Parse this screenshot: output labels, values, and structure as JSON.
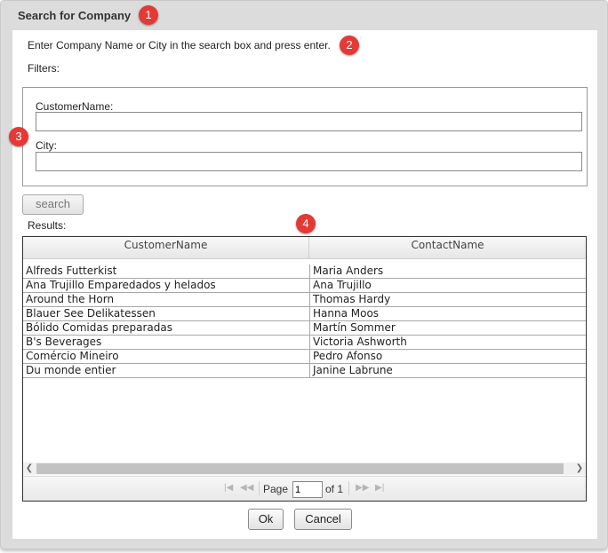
{
  "dialog": {
    "title": "Search for Company",
    "instructions": "Enter Company Name or City in the search box and press enter.",
    "filters_label": "Filters:",
    "results_label": "Results:"
  },
  "badges": [
    "1",
    "2",
    "3",
    "4"
  ],
  "filters": {
    "customer_name": {
      "label": "CustomerName:",
      "value": ""
    },
    "city": {
      "label": "City:",
      "value": ""
    }
  },
  "search_button": "search",
  "grid": {
    "columns": [
      "CustomerName",
      "ContactName"
    ],
    "rows": [
      [
        "Alfreds Futterkist",
        "Maria Anders"
      ],
      [
        "Ana Trujillo Emparedados y helados",
        "Ana Trujillo"
      ],
      [
        "Around the Horn",
        "Thomas Hardy"
      ],
      [
        "Blauer See Delikatessen",
        "Hanna Moos"
      ],
      [
        "Bólido Comidas preparadas",
        "Martín Sommer"
      ],
      [
        "B's Beverages",
        "Victoria Ashworth"
      ],
      [
        "Comércio Mineiro",
        "Pedro Afonso"
      ],
      [
        "Du monde entier",
        "Janine Labrune"
      ]
    ],
    "pager": {
      "page_label": "Page",
      "page_value": "1",
      "of_label": "of 1"
    }
  },
  "buttons": {
    "ok": "Ok",
    "cancel": "Cancel"
  },
  "colors": {
    "badge": "#e53935",
    "dialog_frame": "#dcdcdc"
  },
  "icons": [
    "first-page-icon",
    "prev-page-icon",
    "next-page-icon",
    "last-page-icon",
    "scroll-left-icon",
    "scroll-right-icon"
  ]
}
